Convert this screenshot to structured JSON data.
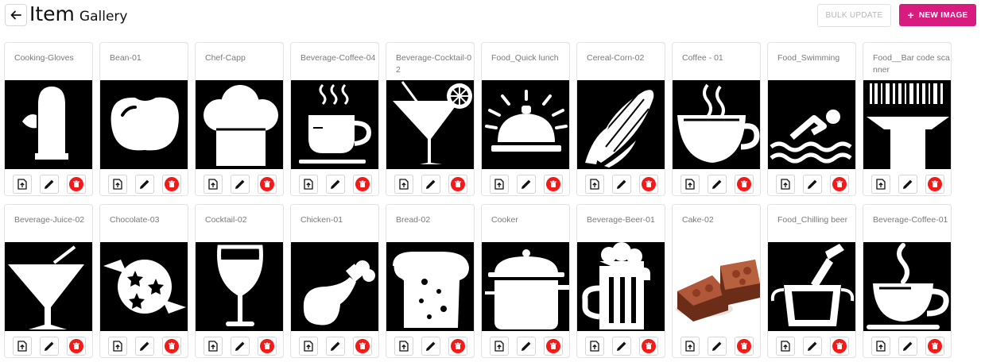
{
  "header": {
    "title_main": "Item",
    "title_sub": "Gallery"
  },
  "toolbar": {
    "bulk_label": "BULK UPDATE",
    "new_label": "NEW IMAGE"
  },
  "colors": {
    "accent": "#d81b7f",
    "delete": "#f31a1a",
    "thumb_bg": "#000000"
  },
  "items": [
    {
      "name": "Cooking-Gloves",
      "icon": "glove-icon"
    },
    {
      "name": "Bean-01",
      "icon": "bean-icon"
    },
    {
      "name": "Chef-Capp",
      "icon": "chef-hat-icon"
    },
    {
      "name": "Beverage-Coffee-04",
      "icon": "coffee-cup-steam-icon"
    },
    {
      "name": "Beverage-Cocktail-02",
      "icon": "cocktail-lemon-icon"
    },
    {
      "name": "Food_Quick lunch",
      "icon": "service-bell-icon"
    },
    {
      "name": "Cereal-Corn-02",
      "icon": "corn-icon"
    },
    {
      "name": "Coffee - 01",
      "icon": "coffee-cup-icon"
    },
    {
      "name": "Food_Swimming",
      "icon": "swimmer-icon"
    },
    {
      "name": "Food__Bar code scanner",
      "icon": "barcode-scanner-icon"
    },
    {
      "name": "Beverage-Juice-02",
      "icon": "juice-glass-icon"
    },
    {
      "name": "Chocolate-03",
      "icon": "candy-icon"
    },
    {
      "name": "Cocktail-02",
      "icon": "wine-glass-icon"
    },
    {
      "name": "Chicken-01",
      "icon": "chicken-leg-icon"
    },
    {
      "name": "Bread-02",
      "icon": "bread-icon"
    },
    {
      "name": "Cooker",
      "icon": "cooker-pot-icon"
    },
    {
      "name": "Beverage-Beer-01",
      "icon": "beer-mug-icon"
    },
    {
      "name": "Cake-02",
      "icon": "cake-photo"
    },
    {
      "name": "Food_Chilling beer",
      "icon": "ice-bucket-icon"
    },
    {
      "name": "Beverage-Coffee-01",
      "icon": "coffee-mug-icon"
    }
  ]
}
